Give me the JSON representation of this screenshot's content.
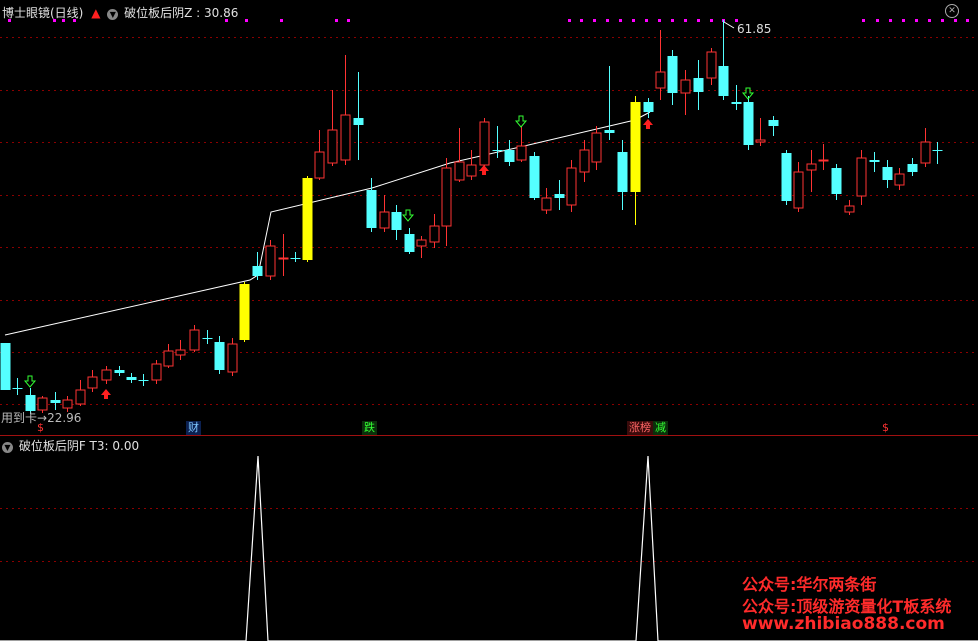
{
  "main_panel": {
    "title": "博士眼镜(日线)",
    "indicator_label": "破位板后阴Z : 30.86",
    "high_label": "61.85",
    "low_label": "22.96",
    "low_prefix": "用到卡",
    "markers": [
      {
        "text": "$",
        "color": "#ff3333"
      },
      {
        "text": "财",
        "color": "#7fc6ff"
      },
      {
        "text": "跌",
        "color": "#33ff33"
      },
      {
        "text": "涨榜",
        "color": "#ff6666"
      },
      {
        "text": "减",
        "color": "#33ff33"
      },
      {
        "text": "$",
        "color": "#ff3333"
      }
    ]
  },
  "sub_panel": {
    "indicator_label": "破位板后阴F  T3: 0.00"
  },
  "watermark": {
    "line1": "公众号:华尔两条街",
    "line2": "公众号:顶级游资量化T板系统",
    "line3": "www.zhibiao888.com"
  },
  "colors": {
    "up": "#ff3333",
    "down": "#54ffff",
    "highlight": "#ffff00",
    "grid": "#8b0000",
    "trend": "#ffffff",
    "dots": "#ff00ff"
  }
}
